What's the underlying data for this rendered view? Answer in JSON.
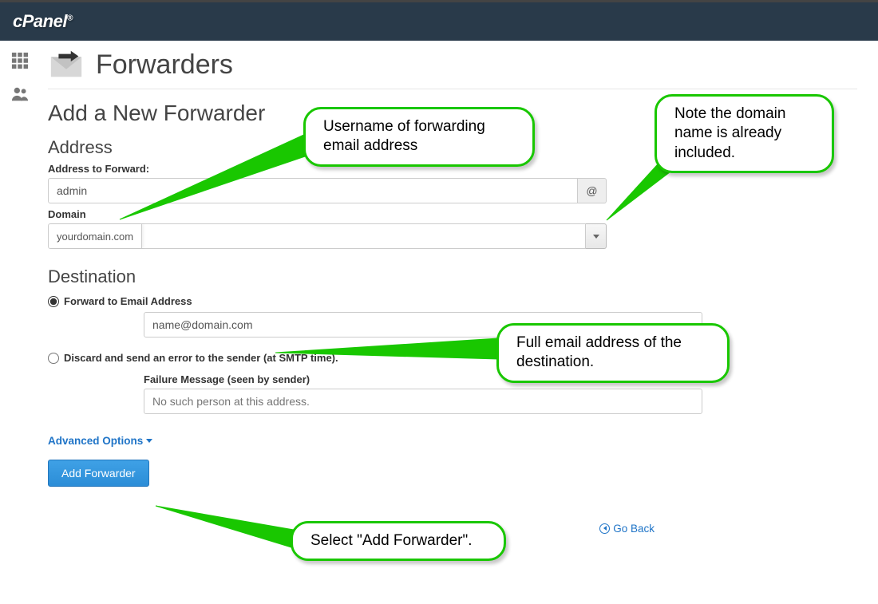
{
  "brand": "cPanel",
  "page": {
    "title": "Forwarders",
    "subtitle": "Add a New Forwarder"
  },
  "section_address": {
    "heading": "Address",
    "address_label": "Address to Forward:",
    "address_value": "admin",
    "at_symbol": "@",
    "domain_label": "Domain",
    "domain_value": "yourdomain.com"
  },
  "section_destination": {
    "heading": "Destination",
    "forward_radio_label": "Forward to Email Address",
    "forward_value": "name@domain.com",
    "discard_radio_label": "Discard and send an error to the sender (at SMTP time).",
    "failure_label": "Failure Message (seen by sender)",
    "failure_placeholder": "No such person at this address."
  },
  "advanced_link": "Advanced Options",
  "submit_button": "Add Forwarder",
  "go_back": "Go Back",
  "annotations": {
    "username_callout": "Username of forwarding email address",
    "domain_callout": "Note the domain name is already included.",
    "destination_callout": "Full email address of the destination.",
    "submit_callout": "Select \"Add Forwarder\"."
  },
  "icons": {
    "grid": "grid-icon",
    "users": "users-icon",
    "envelope": "envelope-forward-icon",
    "caret": "chevron-down-icon",
    "back": "circle-arrow-left-icon"
  }
}
